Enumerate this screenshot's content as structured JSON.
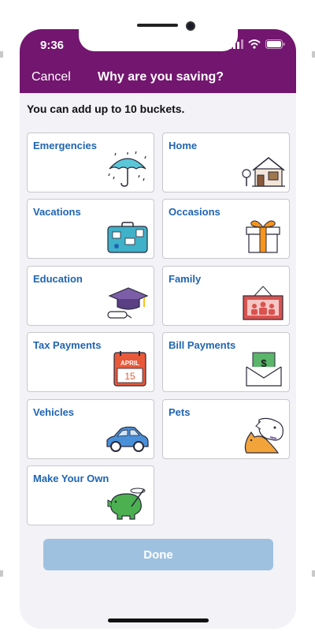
{
  "status": {
    "time": "9:36"
  },
  "nav": {
    "cancel": "Cancel",
    "title": "Why are you saving?"
  },
  "subtitle": "You can add up to 10 buckets.",
  "buckets": [
    {
      "label": "Emergencies",
      "icon": "umbrella-icon"
    },
    {
      "label": "Home",
      "icon": "house-icon"
    },
    {
      "label": "Vacations",
      "icon": "suitcase-icon"
    },
    {
      "label": "Occasions",
      "icon": "gift-icon"
    },
    {
      "label": "Education",
      "icon": "graduation-cap-icon"
    },
    {
      "label": "Family",
      "icon": "family-photo-icon"
    },
    {
      "label": "Tax Payments",
      "icon": "calendar-icon"
    },
    {
      "label": "Bill Payments",
      "icon": "envelope-bill-icon"
    },
    {
      "label": "Vehicles",
      "icon": "car-icon"
    },
    {
      "label": "Pets",
      "icon": "pets-icon"
    },
    {
      "label": "Make Your Own",
      "icon": "piggy-bank-icon"
    }
  ],
  "calendar": {
    "month": "APRIL",
    "day": "15"
  },
  "done": "Done",
  "colors": {
    "brand": "#73166f",
    "link": "#1f64b3",
    "done_disabled": "#9fc1e0",
    "background": "#f2f2f7"
  }
}
